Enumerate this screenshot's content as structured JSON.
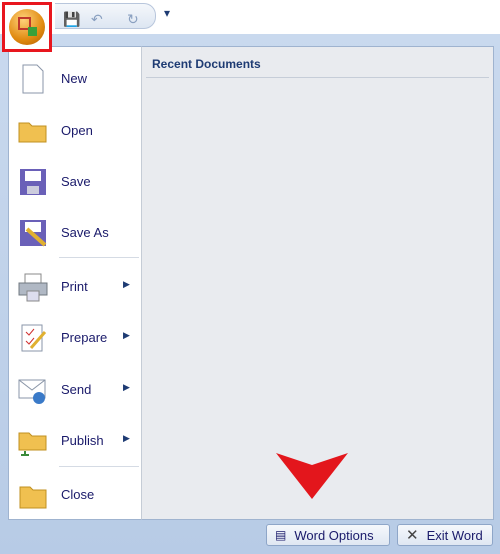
{
  "quick_access": {
    "save": "save-icon",
    "undo": "undo-icon",
    "redo": "redo-icon",
    "customize": "▾"
  },
  "office_button": {
    "icon": "office-logo",
    "highlight_color": "#e8161e"
  },
  "menu": {
    "items": [
      {
        "label": "New",
        "icon": "new-document-icon",
        "submenu": false
      },
      {
        "label": "Open",
        "icon": "open-folder-icon",
        "submenu": false
      },
      {
        "label": "Save",
        "icon": "save-disk-icon",
        "submenu": false
      },
      {
        "label": "Save As",
        "icon": "save-as-icon",
        "submenu": false
      },
      {
        "label": "Print",
        "icon": "printer-icon",
        "submenu": true
      },
      {
        "label": "Prepare",
        "icon": "prepare-icon",
        "submenu": true
      },
      {
        "label": "Send",
        "icon": "send-icon",
        "submenu": true
      },
      {
        "label": "Publish",
        "icon": "publish-icon",
        "submenu": true
      },
      {
        "label": "Close",
        "icon": "close-folder-icon",
        "submenu": false
      }
    ],
    "recent_title": "Recent Documents",
    "word_options": "Word Options",
    "exit_word": "Exit Word",
    "arrow_color": "#e3161c"
  }
}
